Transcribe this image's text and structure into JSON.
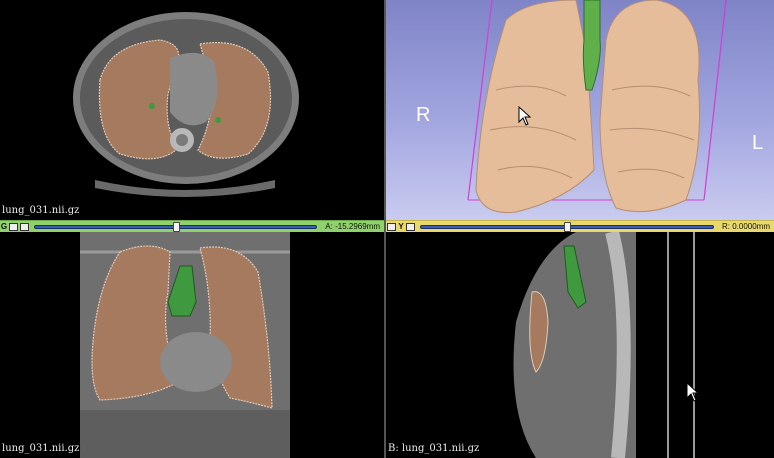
{
  "views": {
    "axial": {
      "label": "lung_031.nii.gz"
    },
    "coronal": {
      "label": "lung_031.nii.gz"
    },
    "sagittal": {
      "label": "B: lung_031.nii.gz"
    },
    "three_d": {
      "left_marker": "R",
      "right_marker": "L"
    }
  },
  "sliders": {
    "green": {
      "letter": "G",
      "value": "A: -15.2969mm",
      "position": 0.5
    },
    "yellow": {
      "letter": "Y",
      "value": "R: 0.0000mm",
      "position": 0.5
    }
  },
  "colors": {
    "lung": "#c89070",
    "airway": "#3f9a3f",
    "three_d_lung": "#e6bd9b",
    "three_d_airway": "#5fb04a",
    "bbox": "#d63cd6",
    "green_bar": "#8fd16b",
    "yellow_bar": "#e9d86c"
  }
}
